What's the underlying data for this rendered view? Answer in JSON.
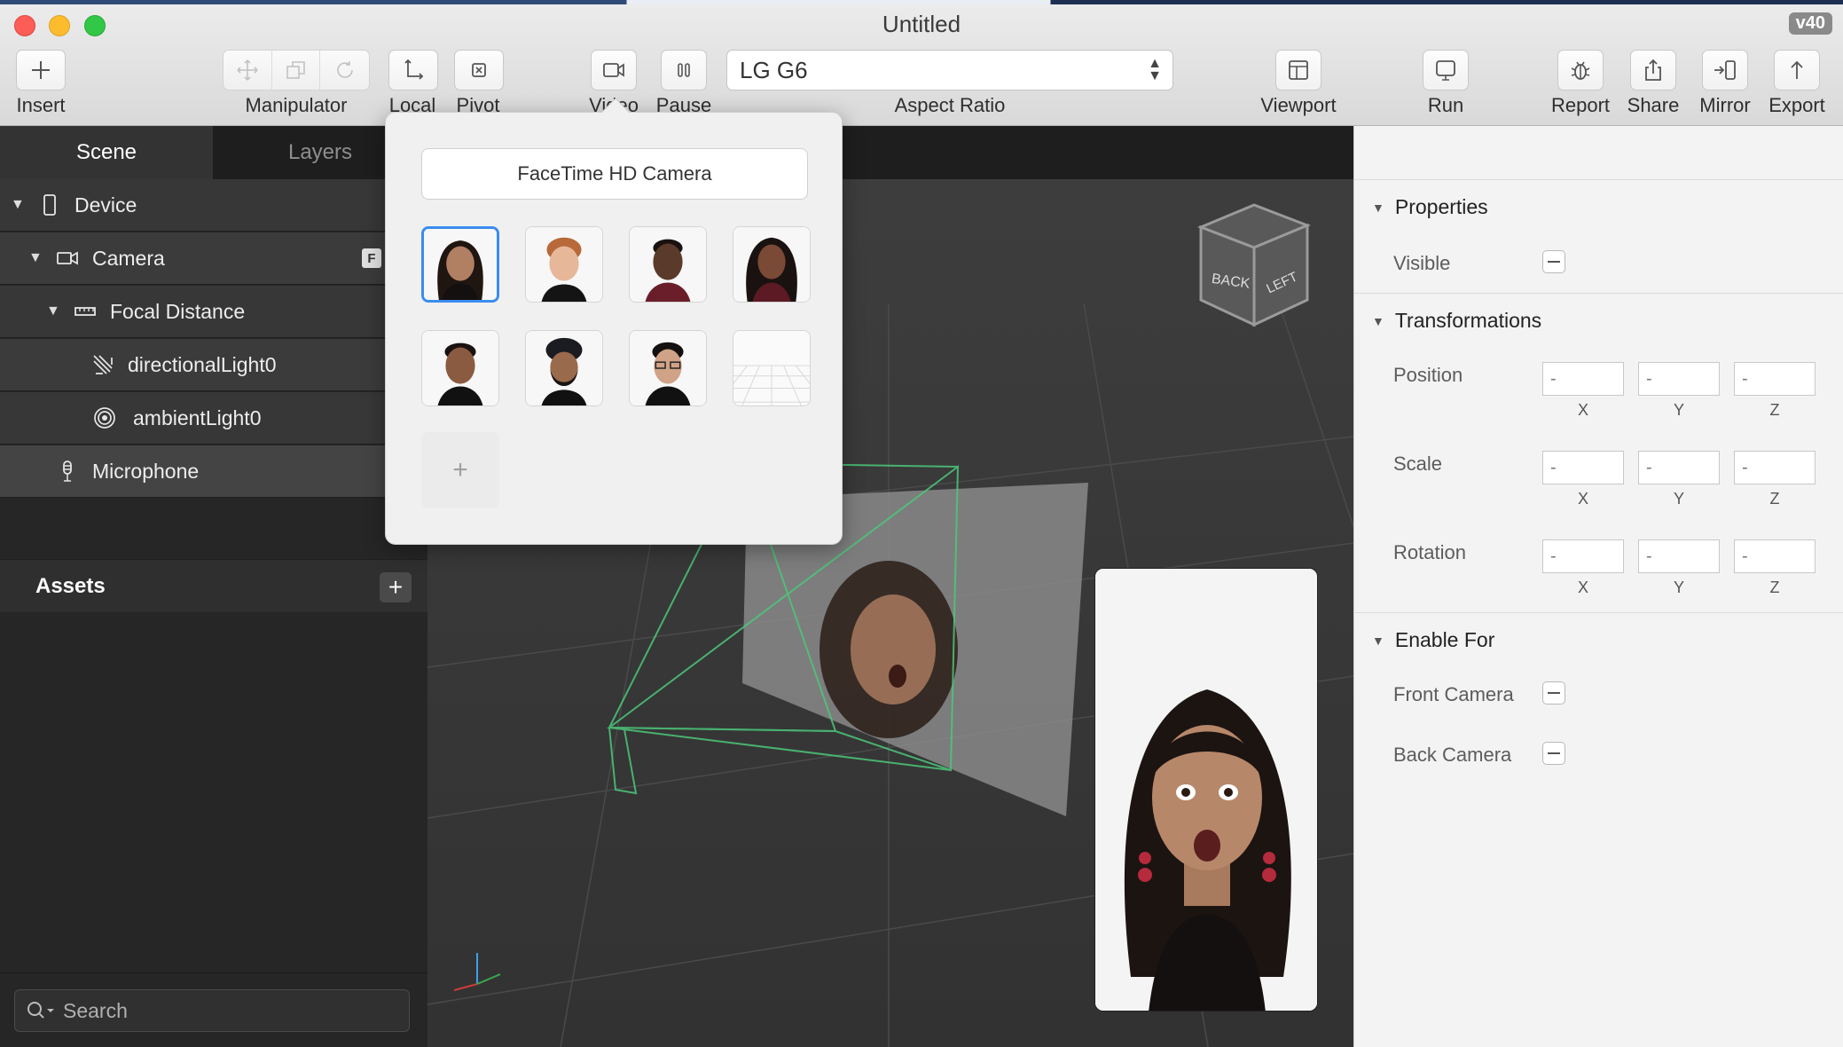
{
  "window": {
    "title": "Untitled",
    "version_badge": "v40"
  },
  "toolbar": {
    "insert": "Insert",
    "manipulator": "Manipulator",
    "local": "Local",
    "pivot": "Pivot",
    "video": "Video",
    "pause": "Pause",
    "device_select": "LG G6",
    "aspect_ratio": "Aspect Ratio",
    "viewport": "Viewport",
    "run": "Run",
    "report": "Report",
    "share": "Share",
    "mirror": "Mirror",
    "export": "Export"
  },
  "sidebar": {
    "tabs": [
      "Scene",
      "Layers"
    ],
    "tree": [
      {
        "label": "Device",
        "icon": "phone-icon"
      },
      {
        "label": "Camera",
        "icon": "video-camera-icon",
        "badge": "F"
      },
      {
        "label": "Focal Distance",
        "icon": "ruler-icon"
      },
      {
        "label": "directionalLight0",
        "icon": "directional-light-icon"
      },
      {
        "label": "ambientLight0",
        "icon": "ambient-light-icon"
      },
      {
        "label": "Microphone",
        "icon": "microphone-icon"
      }
    ],
    "assets": "Assets",
    "search_placeholder": "Search"
  },
  "popover": {
    "camera_button": "FaceTime HD Camera",
    "thumbnails": [
      "face-1",
      "face-2",
      "face-3",
      "face-4",
      "face-5",
      "face-6",
      "face-7",
      "empty-grid"
    ],
    "selected_index": 0
  },
  "viewport": {
    "cube_labels": [
      "BACK",
      "LEFT"
    ]
  },
  "inspector": {
    "sections": {
      "properties": "Properties",
      "transformations": "Transformations",
      "enable_for": "Enable For"
    },
    "visible": "Visible",
    "position": "Position",
    "scale": "Scale",
    "rotation": "Rotation",
    "axes": [
      "X",
      "Y",
      "Z"
    ],
    "field_value": "-",
    "front_camera": "Front Camera",
    "back_camera": "Back Camera"
  },
  "colors": {
    "selection_blue": "#3b8cf0",
    "camera_frustum": "#4cc77a",
    "panel_dark": "#262626"
  }
}
